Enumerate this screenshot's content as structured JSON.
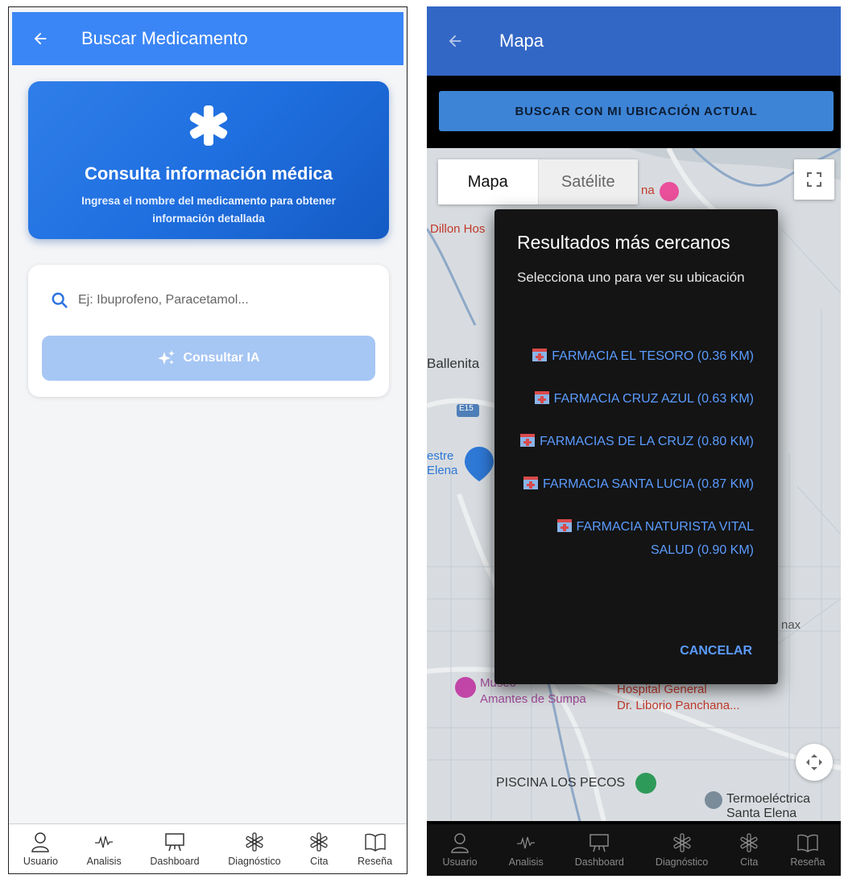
{
  "left": {
    "header": {
      "title": "Buscar Medicamento"
    },
    "hero": {
      "title": "Consulta información médica",
      "subtitle": "Ingresa el nombre del medicamento para obtener información detallada"
    },
    "search": {
      "placeholder": "Ej: Ibuprofeno, Paracetamol...",
      "value": ""
    },
    "consult_button": {
      "label": "Consultar IA"
    },
    "nav": [
      {
        "label": "Usuario",
        "icon": "user-icon"
      },
      {
        "label": "Analisis",
        "icon": "pulse-icon"
      },
      {
        "label": "Dashboard",
        "icon": "easel-icon"
      },
      {
        "label": "Diagnóstico",
        "icon": "asterisk-icon"
      },
      {
        "label": "Cita",
        "icon": "asterisk-icon"
      },
      {
        "label": "Reseña",
        "icon": "book-icon"
      }
    ]
  },
  "right": {
    "header": {
      "title": "Mapa"
    },
    "location_button": {
      "label": "BUSCAR CON MI UBICACIÓN ACTUAL"
    },
    "map": {
      "type_options": [
        "Mapa",
        "Satélite"
      ],
      "selected_type": "Mapa",
      "labels": {
        "dillon": "Dillon Hos",
        "ballenita": "Ballenita",
        "e15": "E15",
        "estre": "estre",
        "elena": "Elena",
        "na": "na",
        "museo": "Museo",
        "amantes": "Amantes de Sumpa",
        "hospital_1": "Hospital General",
        "hospital_2": "Dr. Liborio Panchana...",
        "max": "nax",
        "piscina": "PISCINA LOS PECOS",
        "termo_1": "Termoeléctrica",
        "termo_2": "Santa Elena"
      }
    },
    "dialog": {
      "title": "Resultados más cercanos",
      "subtitle": "Selecciona uno para ver su ubicación",
      "results": [
        "FARMACIA EL TESORO (0.36 KM)",
        "FARMACIA CRUZ AZUL (0.63 KM)",
        "FARMACIAS DE LA CRUZ (0.80 KM)",
        "FARMACIA SANTA LUCIA (0.87 KM)",
        "FARMACIA NATURISTA VITAL SALUD (0.90 KM)"
      ],
      "cancel": "CANCELAR"
    },
    "nav": [
      {
        "label": "Usuario",
        "icon": "user-icon"
      },
      {
        "label": "Analisis",
        "icon": "pulse-icon"
      },
      {
        "label": "Dashboard",
        "icon": "easel-icon"
      },
      {
        "label": "Diagnóstico",
        "icon": "asterisk-icon"
      },
      {
        "label": "Cita",
        "icon": "asterisk-icon"
      },
      {
        "label": "Reseña",
        "icon": "book-icon"
      }
    ]
  },
  "colors": {
    "primary": "#3b86f6",
    "primary_dark_header": "#3367c6",
    "link": "#5b9cff",
    "button_disabled": "#a6c6f4"
  }
}
